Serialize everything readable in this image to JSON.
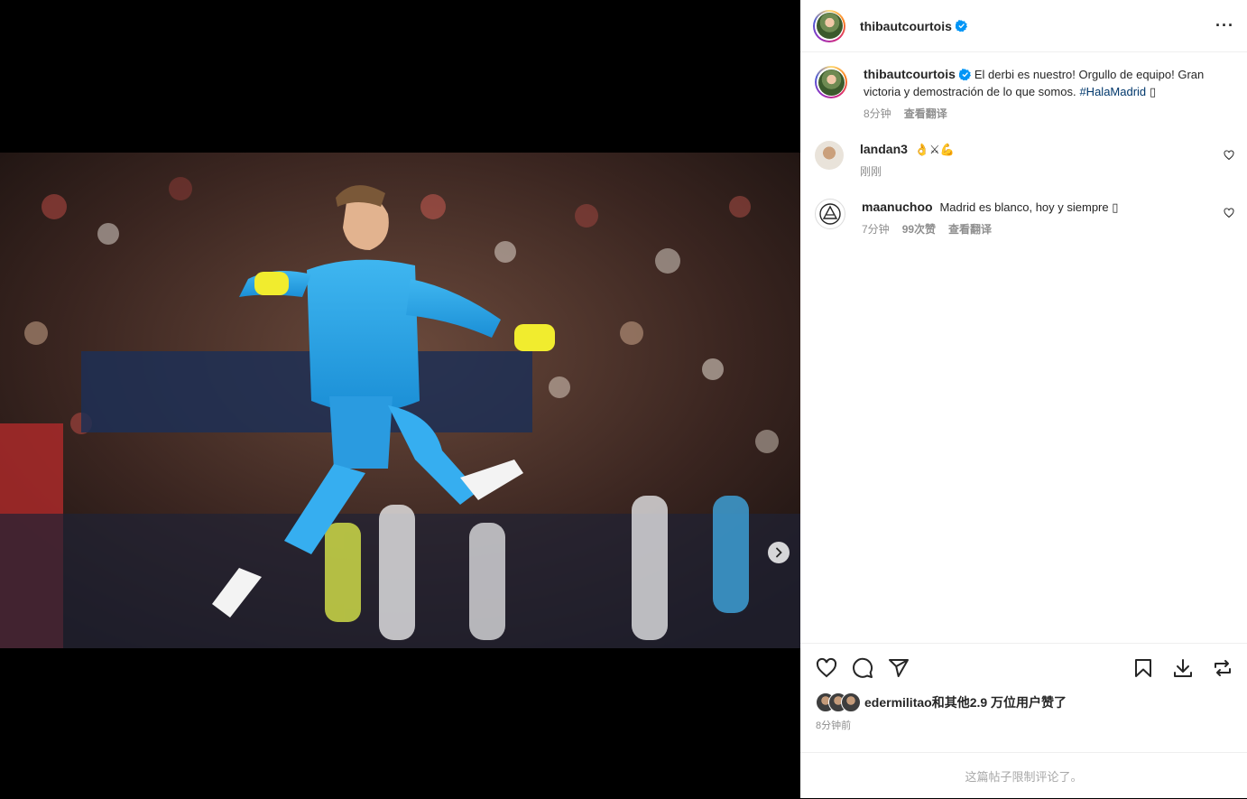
{
  "post": {
    "author": "thibautcourtois",
    "menu_icon": "more-horizontal-icon",
    "caption_text": "El derbi es nuestro! Orgullo de equipo! Gran victoria y demostración de lo que somos.",
    "caption_hashtag": "#HalaMadrid",
    "caption_emoji": "▯",
    "caption_time": "8分钟",
    "see_translation": "查看翻译",
    "carousel": {
      "slide_count": 2,
      "current_slide": 1
    }
  },
  "comments": [
    {
      "user": "landan3",
      "text": "👌⚔💪",
      "time": "刚刚",
      "likes": "",
      "translate": ""
    },
    {
      "user": "maanuchoo",
      "text": "Madrid es blanco, hoy y siempre ▯",
      "time": "7分钟",
      "likes": "99次赞",
      "translate": "查看翻译"
    }
  ],
  "actions": {
    "like": "heart-icon",
    "comment": "comment-icon",
    "share": "send-icon",
    "save": "bookmark-icon",
    "download": "download-icon",
    "repost": "repost-icon"
  },
  "likes_line": {
    "user": "edermilitao",
    "rest": "和其他2.9 万位用户赞了"
  },
  "post_time": "8分钟前",
  "comments_limited": "这篇帖子限制评论了。",
  "colors": {
    "link": "#00376b",
    "verified": "#0095f6",
    "muted": "#8e8e8e"
  }
}
